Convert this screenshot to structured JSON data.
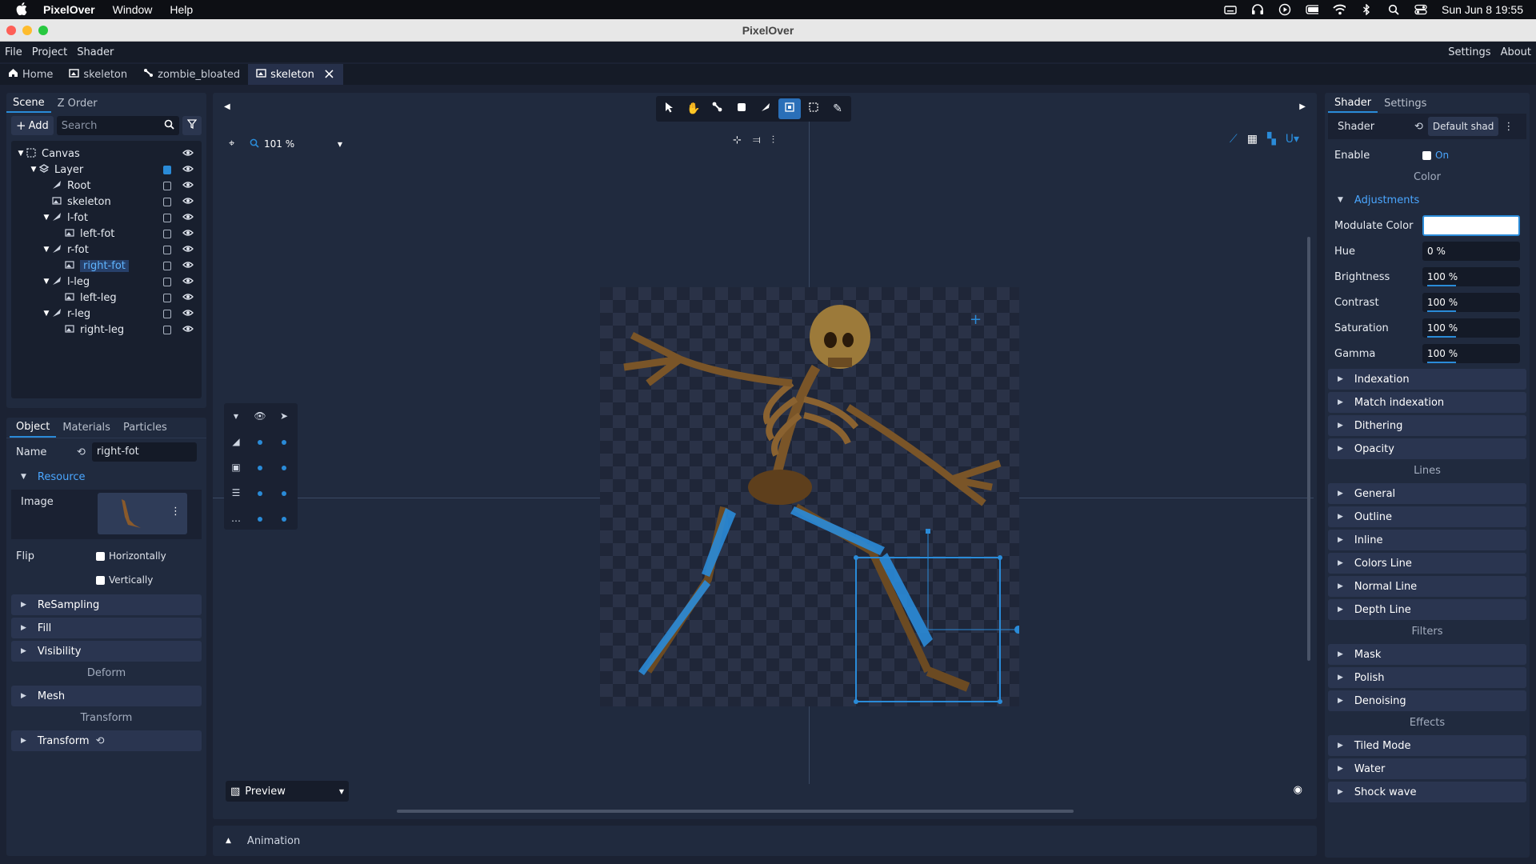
{
  "menubar": {
    "app": "PixelOver",
    "items": [
      "Window",
      "Help"
    ],
    "clock": "Sun Jun 8  19:55"
  },
  "window": {
    "title": "PixelOver"
  },
  "appmenu": {
    "left": [
      "File",
      "Project",
      "Shader"
    ],
    "right": [
      "Settings",
      "About"
    ]
  },
  "tabs": [
    {
      "label": "Home"
    },
    {
      "label": "skeleton"
    },
    {
      "label": "zombie_bloated"
    },
    {
      "label": "skeleton",
      "active": true
    }
  ],
  "scene": {
    "tabs": [
      "Scene",
      "Z Order"
    ],
    "add_label": "Add",
    "search_placeholder": "Search",
    "tree": [
      {
        "label": "Canvas",
        "depth": 0,
        "expanded": true,
        "icon": "canvas-icon"
      },
      {
        "label": "Layer",
        "depth": 1,
        "expanded": true,
        "icon": "layer-icon"
      },
      {
        "label": "Root",
        "depth": 2,
        "icon": "bone-icon"
      },
      {
        "label": "skeleton",
        "depth": 2,
        "icon": "image-icon"
      },
      {
        "label": "l-fot",
        "depth": 2,
        "expanded": true,
        "icon": "bone-icon"
      },
      {
        "label": "left-fot",
        "depth": 3,
        "icon": "image-icon"
      },
      {
        "label": "r-fot",
        "depth": 2,
        "expanded": true,
        "icon": "bone-icon"
      },
      {
        "label": "right-fot",
        "depth": 3,
        "icon": "image-icon",
        "selected": true
      },
      {
        "label": "l-leg",
        "depth": 2,
        "expanded": true,
        "icon": "bone-icon"
      },
      {
        "label": "left-leg",
        "depth": 3,
        "icon": "image-icon"
      },
      {
        "label": "r-leg",
        "depth": 2,
        "expanded": true,
        "icon": "bone-icon"
      },
      {
        "label": "right-leg",
        "depth": 3,
        "icon": "image-icon"
      }
    ]
  },
  "object": {
    "tabs": [
      "Object",
      "Materials",
      "Particles"
    ],
    "name_label": "Name",
    "name_value": "right-fot",
    "resource_label": "Resource",
    "image_label": "Image",
    "flip_label": "Flip",
    "flip_h": "Horizontally",
    "flip_v": "Vertically",
    "sections": [
      "ReSampling",
      "Fill",
      "Visibility"
    ],
    "deform_title": "Deform",
    "mesh_label": "Mesh",
    "transform_title": "Transform",
    "transform_label": "Transform"
  },
  "viewport": {
    "zoom": "101 %",
    "preview_label": "Preview"
  },
  "animation": {
    "label": "Animation"
  },
  "shader": {
    "tabs": [
      "Shader",
      "Settings"
    ],
    "shader_label": "Shader",
    "shader_value": "Default shad",
    "enable_label": "Enable",
    "enable_value": "On",
    "color_title": "Color",
    "adjustments_label": "Adjustments",
    "modulate_label": "Modulate Color",
    "modulate_color": "#ffffff",
    "adjustments": [
      {
        "label": "Hue",
        "value": "0 %"
      },
      {
        "label": "Brightness",
        "value": "100 %"
      },
      {
        "label": "Contrast",
        "value": "100 %"
      },
      {
        "label": "Saturation",
        "value": "100 %"
      },
      {
        "label": "Gamma",
        "value": "100 %"
      }
    ],
    "color_sections": [
      "Indexation",
      "Match indexation",
      "Dithering",
      "Opacity"
    ],
    "lines_title": "Lines",
    "lines_sections": [
      "General",
      "Outline",
      "Inline",
      "Colors Line",
      "Normal Line",
      "Depth Line"
    ],
    "filters_title": "Filters",
    "filters_sections": [
      "Mask",
      "Polish",
      "Denoising"
    ],
    "effects_title": "Effects",
    "effects_sections": [
      "Tiled Mode",
      "Water",
      "Shock wave"
    ]
  },
  "colors": {
    "accent": "#2a8bd8",
    "panel": "#202a3e",
    "background": "#1b2233"
  }
}
